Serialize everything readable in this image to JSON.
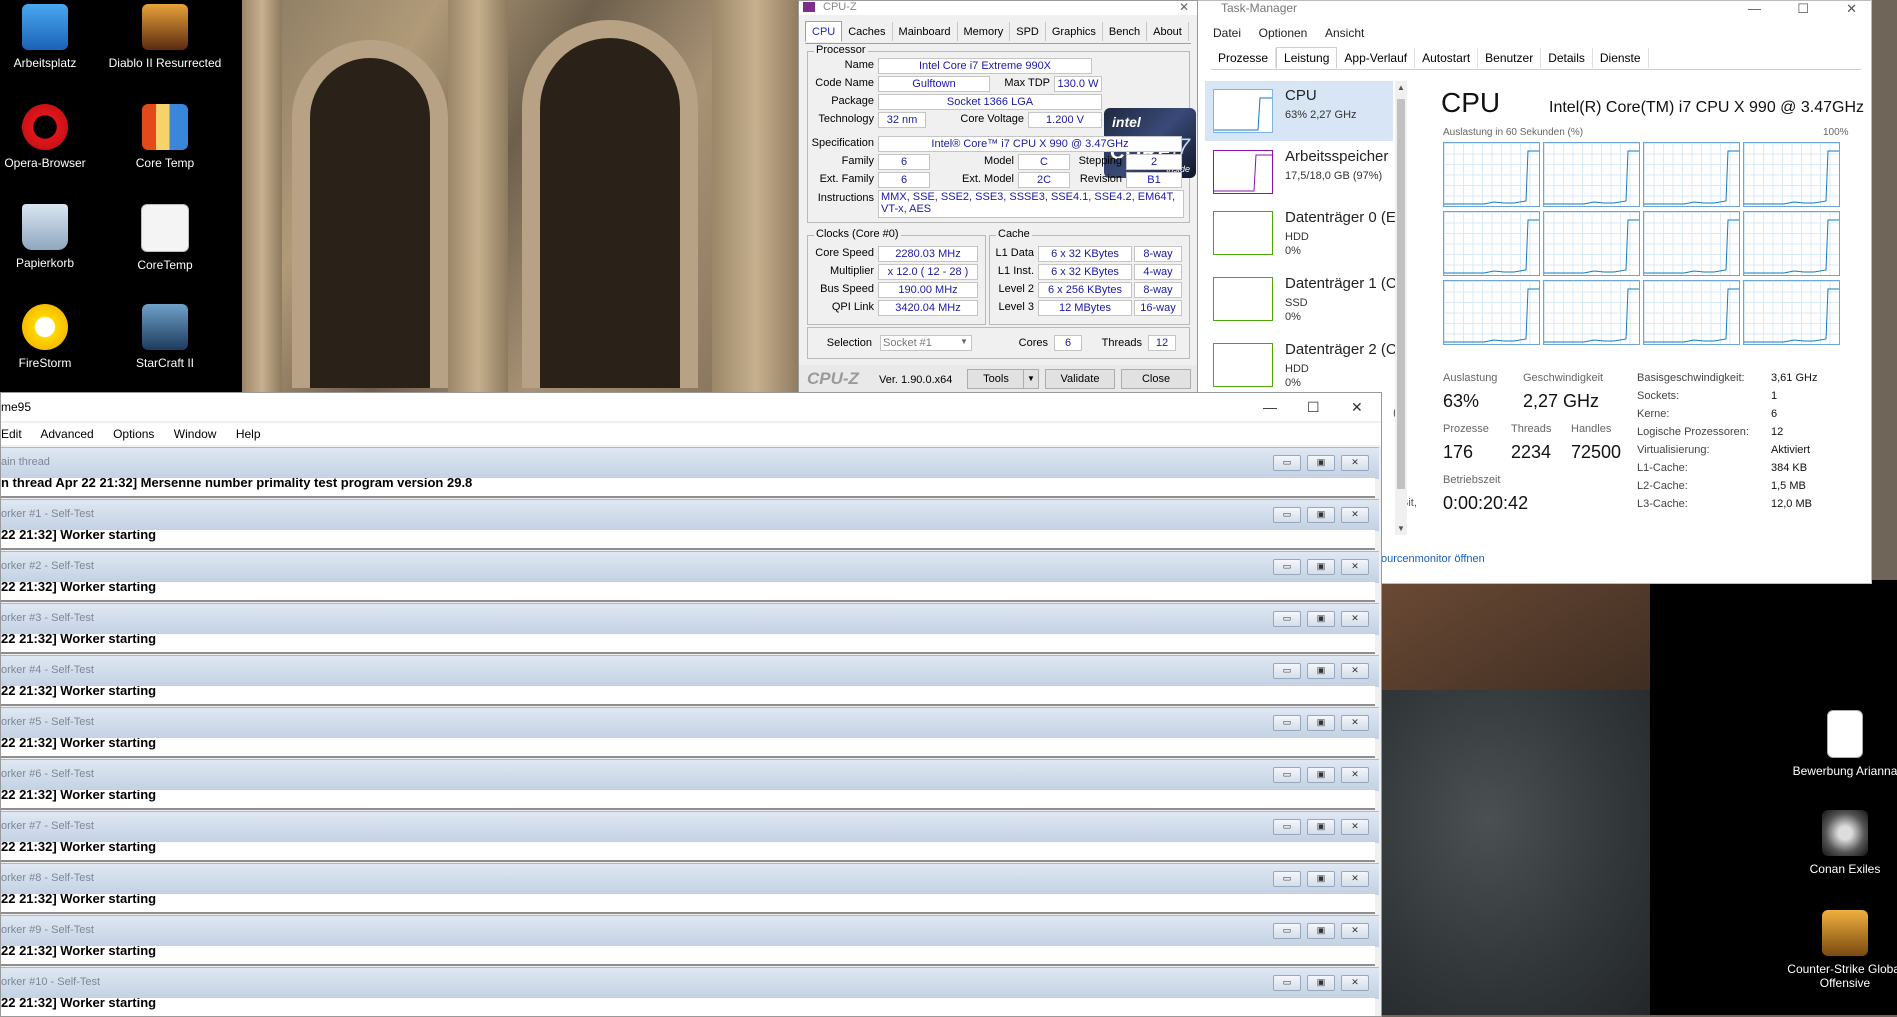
{
  "desktop": {
    "left_icons": [
      {
        "label": "Arbeitsplatz",
        "icon": "computer-icon"
      },
      {
        "label": "Diablo II Resurrected",
        "icon": "diablo-icon"
      },
      {
        "label": "Opera-Browser",
        "icon": "opera-icon"
      },
      {
        "label": "Core Temp",
        "icon": "thermometer-icon"
      },
      {
        "label": "Papierkorb",
        "icon": "recycle-bin-icon"
      },
      {
        "label": "CoreTemp",
        "icon": "file-icon"
      },
      {
        "label": "FireStorm",
        "icon": "firestorm-icon"
      },
      {
        "label": "StarCraft II",
        "icon": "starcraft-icon"
      }
    ],
    "right_icons": [
      {
        "label": "Bewerbung Arianna",
        "icon": "pdf-file-icon"
      },
      {
        "label": "Conan Exiles",
        "icon": "conan-exiles-icon"
      },
      {
        "label": "Counter-Strike Global Offensive",
        "icon": "csgo-icon"
      }
    ]
  },
  "cpuz": {
    "title": "CPU-Z",
    "tabs": [
      "CPU",
      "Caches",
      "Mainboard",
      "Memory",
      "SPD",
      "Graphics",
      "Bench",
      "About"
    ],
    "active_tab": "CPU",
    "processor": {
      "group_title": "Processor",
      "name_label": "Name",
      "name": "Intel Core i7 Extreme 990X",
      "codename_label": "Code Name",
      "codename": "Gulftown",
      "maxtdp_label": "Max TDP",
      "maxtdp": "130.0 W",
      "package_label": "Package",
      "package": "Socket 1366 LGA",
      "technology_label": "Technology",
      "technology": "32 nm",
      "corevoltage_label": "Core Voltage",
      "corevoltage": "1.200 V",
      "spec_label": "Specification",
      "spec": "Intel® Core™ i7 CPU     X 990  @ 3.47GHz",
      "family_label": "Family",
      "family": "6",
      "model_label": "Model",
      "model": "C",
      "stepping_label": "Stepping",
      "stepping": "2",
      "extfamily_label": "Ext. Family",
      "extfamily": "6",
      "extmodel_label": "Ext. Model",
      "extmodel": "2C",
      "revision_label": "Revision",
      "revision": "B1",
      "instructions_label": "Instructions",
      "instructions": "MMX, SSE, SSE2, SSE3, SSSE3, SSE4.1, SSE4.2, EM64T, VT-x, AES"
    },
    "logo": {
      "brand": "intel",
      "line": "CORE",
      "model": "i7",
      "tag": "inside"
    },
    "clocks": {
      "group_title": "Clocks (Core #0)",
      "corespeed_label": "Core Speed",
      "corespeed": "2280.03 MHz",
      "multiplier_label": "Multiplier",
      "multiplier": "x 12.0 ( 12 - 28 )",
      "busspeed_label": "Bus Speed",
      "busspeed": "190.00 MHz",
      "qpi_label": "QPI Link",
      "qpi": "3420.04 MHz"
    },
    "cache": {
      "group_title": "Cache",
      "rows": [
        {
          "label": "L1 Data",
          "size": "6 x 32 KBytes",
          "way": "8-way"
        },
        {
          "label": "L1 Inst.",
          "size": "6 x 32 KBytes",
          "way": "4-way"
        },
        {
          "label": "Level 2",
          "size": "6 x 256 KBytes",
          "way": "8-way"
        },
        {
          "label": "Level 3",
          "size": "12 MBytes",
          "way": "16-way"
        }
      ]
    },
    "selection_label": "Selection",
    "selection": "Socket #1",
    "cores_label": "Cores",
    "cores": "6",
    "threads_label": "Threads",
    "threads": "12",
    "footer_brand": "CPU-Z",
    "version": "Ver. 1.90.0.x64",
    "tools_label": "Tools",
    "validate_label": "Validate",
    "close_label": "Close"
  },
  "taskmgr": {
    "title": "Task-Manager",
    "menu": [
      "Datei",
      "Optionen",
      "Ansicht"
    ],
    "tabs": [
      "Prozesse",
      "Leistung",
      "App-Verlauf",
      "Autostart",
      "Benutzer",
      "Details",
      "Dienste"
    ],
    "active_tab": "Leistung",
    "resources": [
      {
        "name": "CPU",
        "sub1": "63%  2,27 GHz",
        "sub2": "",
        "color": "#117dbb"
      },
      {
        "name": "Arbeitsspeicher",
        "sub1": "17,5/18,0 GB (97%)",
        "sub2": "",
        "color": "#8b12ae"
      },
      {
        "name": "Datenträger 0 (E",
        "sub1": "HDD",
        "sub2": "0%",
        "color": "#4da60c"
      },
      {
        "name": "Datenträger 1 (C",
        "sub1": "SSD",
        "sub2": "0%",
        "color": "#4da60c"
      },
      {
        "name": "Datenträger 2 (C",
        "sub1": "HDD",
        "sub2": "0%",
        "color": "#4da60c"
      }
    ],
    "cpu_header": "CPU",
    "cpu_model": "Intel(R) Core(TM) i7 CPU X 990 @ 3.47GHz",
    "graph_caption": "Auslastung in 60 Sekunden (%)",
    "graph_max": "100%",
    "stats": {
      "auslastung_label": "Auslastung",
      "auslastung": "63%",
      "speed_label": "Geschwindigkeit",
      "speed": "2,27 GHz",
      "prozesse_label": "Prozesse",
      "prozesse": "176",
      "threads_label": "Threads",
      "threads": "2234",
      "handles_label": "Handles",
      "handles": "72500",
      "uptime_label": "Betriebszeit",
      "uptime": "0:00:20:42"
    },
    "details": [
      {
        "k": "Basisgeschwindigkeit:",
        "v": "3,61 GHz"
      },
      {
        "k": "Sockets:",
        "v": "1"
      },
      {
        "k": "Kerne:",
        "v": "6"
      },
      {
        "k": "Logische Prozessoren:",
        "v": "12"
      },
      {
        "k": "Virtualisierung:",
        "v": "Aktiviert"
      },
      {
        "k": "L1-Cache:",
        "v": "384 KB"
      },
      {
        "k": "L2-Cache:",
        "v": "1,5 MB"
      },
      {
        "k": "L3-Cache:",
        "v": "12,0 MB"
      }
    ],
    "resmon_link": "ourcenmonitor öffnen",
    "peek_text_1": "Bit,",
    "peek_text_2": "(F"
  },
  "prime95": {
    "title": "me95",
    "menu": [
      "Edit",
      "Advanced",
      "Options",
      "Window",
      "Help"
    ],
    "children": [
      {
        "title": "ain thread",
        "text": "n thread Apr 22 21:32] Mersenne number primality test program version 29.8"
      },
      {
        "title": "orker #1 - Self-Test",
        "text": "22 21:32] Worker starting"
      },
      {
        "title": "orker #2 - Self-Test",
        "text": "22 21:32] Worker starting"
      },
      {
        "title": "orker #3 - Self-Test",
        "text": "22 21:32] Worker starting"
      },
      {
        "title": "orker #4 - Self-Test",
        "text": "22 21:32] Worker starting"
      },
      {
        "title": "orker #5 - Self-Test",
        "text": "22 21:32] Worker starting"
      },
      {
        "title": "orker #6 - Self-Test",
        "text": "22 21:32] Worker starting"
      },
      {
        "title": "orker #7 - Self-Test",
        "text": "22 21:32] Worker starting"
      },
      {
        "title": "orker #8 - Self-Test",
        "text": "22 21:32] Worker starting"
      },
      {
        "title": "orker #9 - Self-Test",
        "text": "22 21:32] Worker starting"
      },
      {
        "title": "orker #10 - Self-Test",
        "text": "22 21:32] Worker starting"
      }
    ]
  }
}
